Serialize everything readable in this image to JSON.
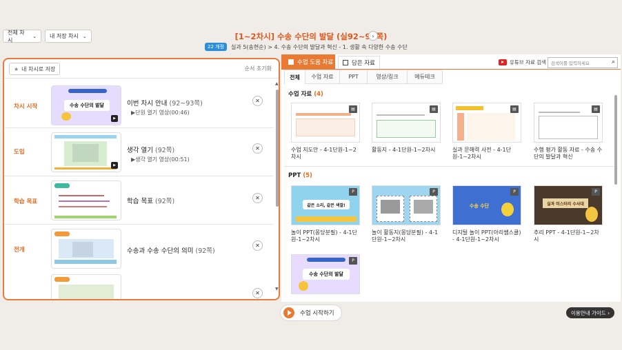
{
  "top": {
    "filter_all": "전체 차시",
    "filter_saved": "내 저장 차시",
    "lesson_title": "[1~2차시] 수송 수단의 발달 (실92~93쪽)",
    "badge": "22 개정",
    "breadcrumb": "실과 5(송현순)  >  4. 수송 수단의 발달과 혁신 - 1. 생활 속 다양한 수송 수단"
  },
  "left": {
    "save_label": "내 차시로 저장",
    "reset_label": "순서 초기화",
    "rows": [
      {
        "stage": "차시 시작",
        "title": "이번 차시 안내",
        "page": "(92~93쪽)",
        "sub": "▶단원 열기 영상(00:46)",
        "thumb_text": "수송 수단의 발달"
      },
      {
        "stage": "도입",
        "title": "생각 열기",
        "page": "(92쪽)",
        "sub": "▶생각 열기 영상(00:51)",
        "thumb_text": ""
      },
      {
        "stage": "학습 목표",
        "title": "학습 목표",
        "page": "(92쪽)",
        "sub": "",
        "thumb_text": ""
      },
      {
        "stage": "전개",
        "title": "수송과 수송 수단의 의미",
        "page": "(92쪽)",
        "sub": "",
        "thumb_text": ""
      }
    ]
  },
  "right": {
    "tab_materials": "수업 도움 자료",
    "tab_saved": "담은 자료",
    "youtube_label": "유튜브 자료 검색",
    "search_placeholder": "검색어를 입력하세요",
    "subtabs": [
      "전체",
      "수업 자료",
      "PPT",
      "영상/링크",
      "에듀테크"
    ],
    "section_materials": "수업 자료",
    "section_materials_count": "(4)",
    "section_ppt": "PPT",
    "section_ppt_count": "(5)",
    "materials": [
      {
        "label": "수업 지도안 - 4-1단원-1~2차시",
        "tag": "▤"
      },
      {
        "label": "활동지 - 4-1단원-1~2차시",
        "tag": "▤"
      },
      {
        "label": "실과 문해력 사전 - 4-1단원-1~2차시",
        "tag": "▤"
      },
      {
        "label": "수행 평가 활동 자료 - 수송 수단의 발달과 혁신",
        "tag": "▤"
      }
    ],
    "ppts": [
      {
        "label": "놀이 PPT(몽당분필) - 4-1단원-1~2차시",
        "tag": "P",
        "thumb_text": "같은 소리, 같은 색깔!"
      },
      {
        "label": "놀이 활동지(몽당분필) - 4-1단원-1~2차시",
        "tag": "P",
        "thumb_text": ""
      },
      {
        "label": "디지털 놀이 PPT(아리쌤스쿨) - 4-1단원-1~2차시",
        "tag": "P",
        "thumb_text": "수송 수단"
      },
      {
        "label": "추리 PPT - 4-1단원-1~2차시",
        "tag": "P",
        "thumb_text": "실과 미스터리 수사대"
      },
      {
        "label": "",
        "tag": "P",
        "thumb_text": "수송 수단의 발달"
      }
    ]
  },
  "bottom": {
    "start_label": "수업 시작하기",
    "guide_label": "이용안내 가이드 ›"
  },
  "colors": {
    "accent": "#e87a33",
    "badge": "#2a8fd8"
  }
}
